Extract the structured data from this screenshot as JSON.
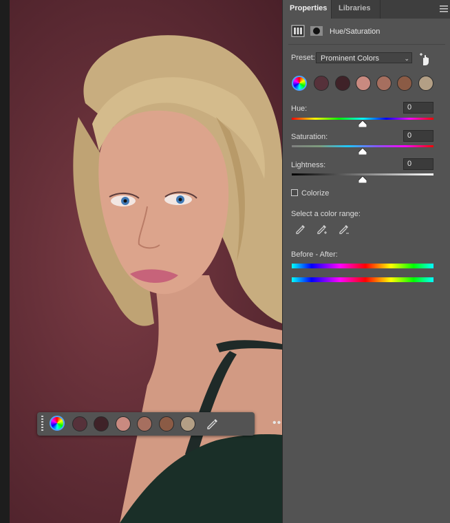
{
  "panel": {
    "tabs": [
      {
        "label": "Properties",
        "active": true
      },
      {
        "label": "Libraries",
        "active": false
      }
    ],
    "adjustment_title": "Hue/Saturation",
    "preset_label": "Preset:",
    "preset_value": "Prominent Colors",
    "swatches": [
      "color-wheel",
      "#56313a",
      "#3f2228",
      "#c98a80",
      "#a66f5f",
      "#8b5b45",
      "#b39f85"
    ],
    "hue": {
      "label": "Hue:",
      "value": "0"
    },
    "saturation": {
      "label": "Saturation:",
      "value": "0"
    },
    "lightness": {
      "label": "Lightness:",
      "value": "0"
    },
    "colorize_label": "Colorize",
    "colorize_checked": false,
    "color_range_label": "Select a color range:",
    "before_after_label": "Before - After:"
  },
  "floating_bar": {
    "swatches": [
      "color-wheel",
      "#56313a",
      "#3f2228",
      "#c98a80",
      "#a66f5f",
      "#8b5b45",
      "#b39f85"
    ],
    "more_label": "•••"
  },
  "colors": {
    "accent": "#4aa3ff",
    "panel_bg": "#535353",
    "background": "#5f2c35"
  }
}
